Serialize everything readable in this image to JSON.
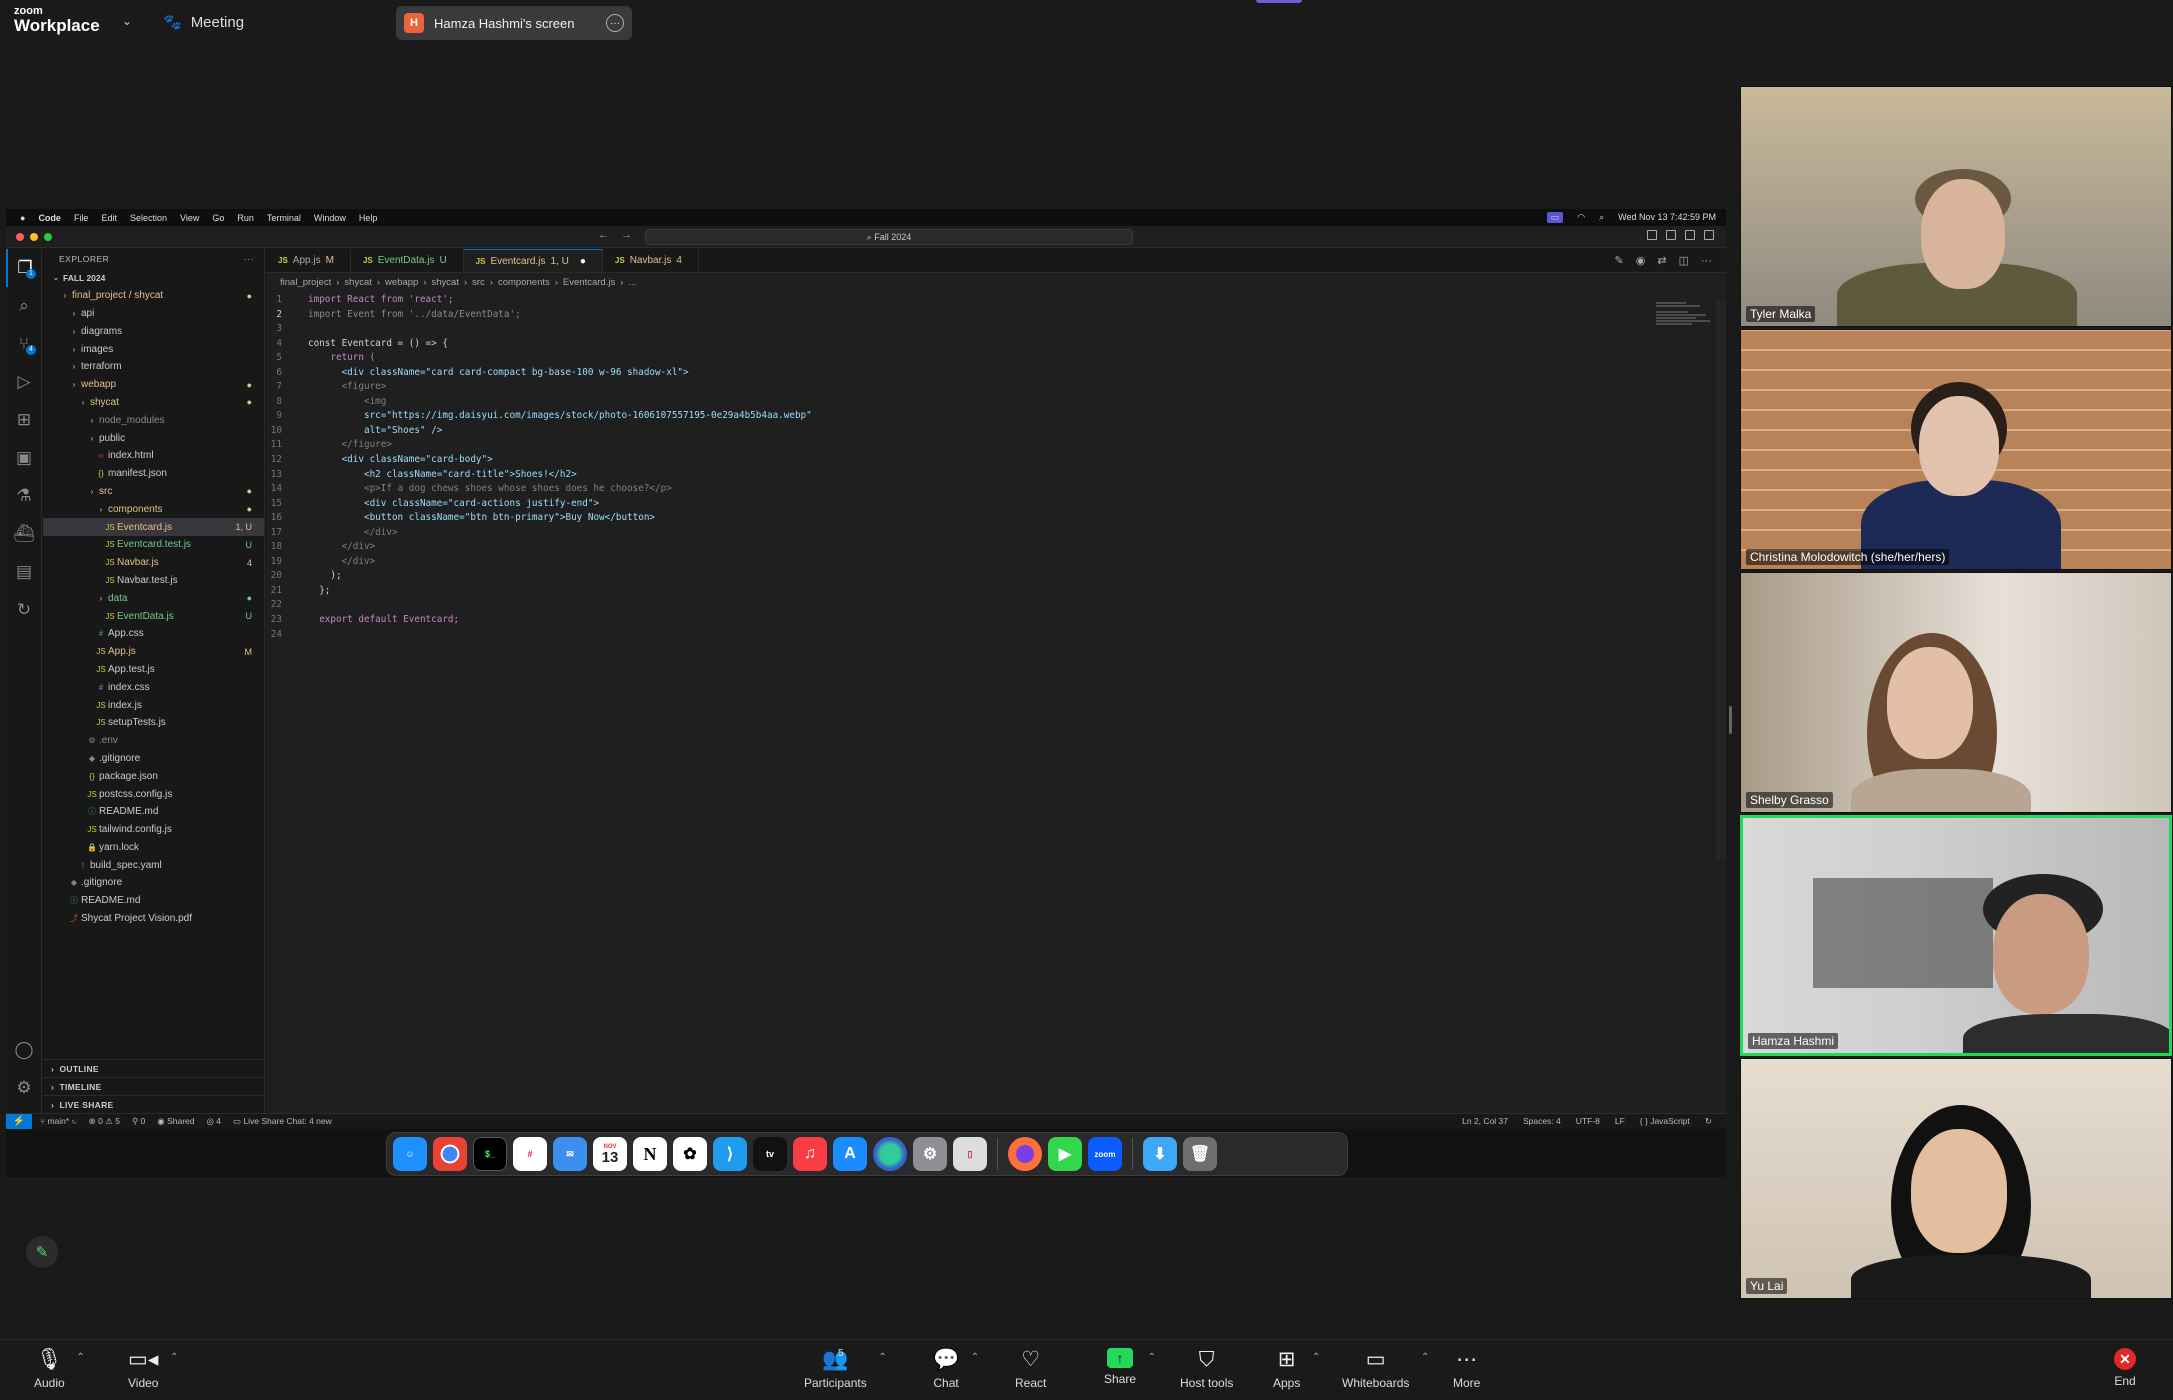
{
  "topbar": {
    "logo_small": "zoom",
    "logo_big": "Workplace",
    "meeting_label": "Meeting",
    "screen_badge": "H",
    "screen_label": "Hamza Hashmi's screen"
  },
  "mac_menu": {
    "app": "Code",
    "items": [
      "File",
      "Edit",
      "Selection",
      "View",
      "Go",
      "Run",
      "Terminal",
      "Window",
      "Help"
    ],
    "clock": "Wed Nov 13  7:42:59 PM"
  },
  "vscode": {
    "search_box": "Fall 2024",
    "explorer_title": "EXPLORER",
    "explorer_more": "···",
    "scm_badge": "4",
    "files_badge": "1",
    "tree": [
      {
        "label": "FALL 2024",
        "depth": 0,
        "type": "root"
      },
      {
        "label": "final_project / shycat",
        "depth": 1,
        "type": "folder",
        "color": "#e2c08d",
        "status": "●"
      },
      {
        "label": "api",
        "depth": 2,
        "type": "folder"
      },
      {
        "label": "diagrams",
        "depth": 2,
        "type": "folder"
      },
      {
        "label": "images",
        "depth": 2,
        "type": "folder"
      },
      {
        "label": "terraform",
        "depth": 2,
        "type": "folder"
      },
      {
        "label": "webapp",
        "depth": 2,
        "type": "folder",
        "color": "#e2c08d",
        "status": "●"
      },
      {
        "label": "shycat",
        "depth": 3,
        "type": "folder",
        "color": "#e2c08d",
        "status": "●"
      },
      {
        "label": "node_modules",
        "depth": 4,
        "type": "folder",
        "color": "#8c8c8c"
      },
      {
        "label": "public",
        "depth": 4,
        "type": "folder"
      },
      {
        "label": "index.html",
        "depth": 5,
        "type": "html"
      },
      {
        "label": "manifest.json",
        "depth": 5,
        "type": "json"
      },
      {
        "label": "src",
        "depth": 4,
        "type": "folder",
        "color": "#e2c08d",
        "status": "●"
      },
      {
        "label": "components",
        "depth": 5,
        "type": "folder",
        "color": "#e2c08d",
        "status": "●"
      },
      {
        "label": "Eventcard.js",
        "depth": 6,
        "type": "js",
        "color": "#e2c08d",
        "status": "1, U",
        "selected": true
      },
      {
        "label": "Eventcard.test.js",
        "depth": 6,
        "type": "js",
        "color": "#73c991",
        "status": "U"
      },
      {
        "label": "Navbar.js",
        "depth": 6,
        "type": "js",
        "color": "#e2c08d",
        "status": "4"
      },
      {
        "label": "Navbar.test.js",
        "depth": 6,
        "type": "js"
      },
      {
        "label": "data",
        "depth": 5,
        "type": "folder",
        "color": "#73c991",
        "status": "●"
      },
      {
        "label": "EventData.js",
        "depth": 6,
        "type": "js",
        "color": "#73c991",
        "status": "U"
      },
      {
        "label": "App.css",
        "depth": 5,
        "type": "css"
      },
      {
        "label": "App.js",
        "depth": 5,
        "type": "js",
        "color": "#e2c08d",
        "status": "M"
      },
      {
        "label": "App.test.js",
        "depth": 5,
        "type": "js"
      },
      {
        "label": "index.css",
        "depth": 5,
        "type": "css"
      },
      {
        "label": "index.js",
        "depth": 5,
        "type": "js"
      },
      {
        "label": "setupTests.js",
        "depth": 5,
        "type": "js"
      },
      {
        "label": ".env",
        "depth": 4,
        "type": "env",
        "color": "#8c8c8c"
      },
      {
        "label": ".gitignore",
        "depth": 4,
        "type": "git"
      },
      {
        "label": "package.json",
        "depth": 4,
        "type": "json"
      },
      {
        "label": "postcss.config.js",
        "depth": 4,
        "type": "js"
      },
      {
        "label": "README.md",
        "depth": 4,
        "type": "md"
      },
      {
        "label": "tailwind.config.js",
        "depth": 4,
        "type": "js"
      },
      {
        "label": "yarn.lock",
        "depth": 4,
        "type": "lock"
      },
      {
        "label": "build_spec.yaml",
        "depth": 3,
        "type": "yaml"
      },
      {
        "label": ".gitignore",
        "depth": 2,
        "type": "git"
      },
      {
        "label": "README.md",
        "depth": 2,
        "type": "md"
      },
      {
        "label": "Shycat Project Vision.pdf",
        "depth": 2,
        "type": "pdf"
      }
    ],
    "sidebar_footer": [
      "OUTLINE",
      "TIMELINE",
      "LIVE SHARE"
    ],
    "tabs": [
      {
        "label": "App.js",
        "badge": "M",
        "active": false
      },
      {
        "label": "EventData.js",
        "badge": "U",
        "active": false
      },
      {
        "label": "Eventcard.js",
        "badge": "1, U",
        "active": true
      },
      {
        "label": "Navbar.js",
        "badge": "4",
        "active": false
      }
    ],
    "breadcrumb": [
      "final_project",
      "shycat",
      "webapp",
      "shycat",
      "src",
      "components",
      "Eventcard.js",
      "..."
    ],
    "code_lines": [
      "import React from 'react';",
      "import Event from '../data/EventData';",
      "",
      "const Eventcard = () => {",
      "    return (",
      "      <div className=\"card card-compact bg-base-100 w-96 shadow-xl\">",
      "      <figure>",
      "          <img",
      "          src=\"https://img.daisyui.com/images/stock/photo-1606107557195-0e29a4b5b4aa.webp\"",
      "          alt=\"Shoes\" />",
      "      </figure>",
      "      <div className=\"card-body\">",
      "          <h2 className=\"card-title\">Shoes!</h2>",
      "          <p>If a dog chews shoes whose shoes does he choose?</p>",
      "          <div className=\"card-actions justify-end\">",
      "          <button className=\"btn btn-primary\">Buy Now</button>",
      "          </div>",
      "      </div>",
      "      </div>",
      "    );",
      "  };",
      "",
      "  export default Eventcard;",
      ""
    ],
    "status": {
      "branch": "main*",
      "errors": "⊗ 0 ⚠ 5",
      "ports": "⚲ 0",
      "shared": "Shared",
      "participants": "4",
      "live_chat": "Live Share Chat: 4 new",
      "cursor": "Ln 2, Col 37",
      "spaces": "Spaces: 4",
      "encoding": "UTF-8",
      "eol": "LF",
      "language": "JavaScript"
    }
  },
  "dock": {
    "calendar_month": "NOV",
    "calendar_day": "13",
    "tv_label": "tv",
    "zoom_label": "zoom"
  },
  "participants": [
    {
      "name": "Tyler Malka",
      "speaking": false
    },
    {
      "name": "Christina Molodowitch (she/her/hers)",
      "speaking": false
    },
    {
      "name": "Shelby Grasso",
      "speaking": false
    },
    {
      "name": "Hamza Hashmi",
      "speaking": true
    },
    {
      "name": "Yu Lai",
      "speaking": false
    }
  ],
  "toolbar": {
    "audio": "Audio",
    "video": "Video",
    "participants": "Participants",
    "participants_count": "5",
    "chat": "Chat",
    "react": "React",
    "share": "Share",
    "host_tools": "Host tools",
    "apps": "Apps",
    "whiteboards": "Whiteboards",
    "more": "More",
    "end": "End"
  },
  "colors": {
    "accent": "#0078d4",
    "speaker": "#23d959",
    "end": "#e02828"
  }
}
